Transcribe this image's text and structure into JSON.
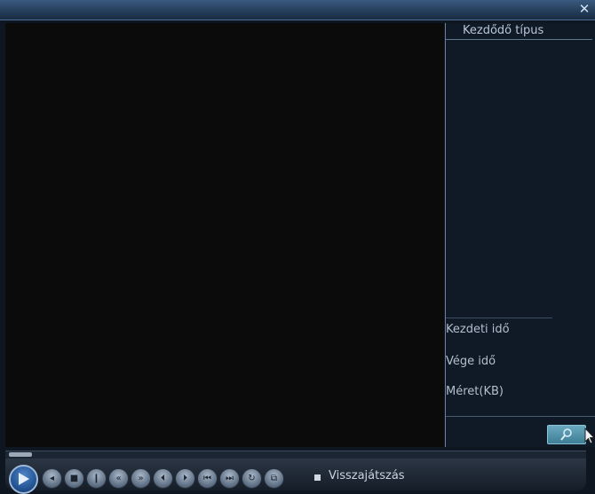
{
  "window": {
    "close_symbol": "✕"
  },
  "file_list": {
    "header_label": "Kezdődő típus"
  },
  "file_info": {
    "start_time_label": "Kezdeti idő",
    "end_time_label": "Vége idő",
    "size_label": "Méret(KB)"
  },
  "playback": {
    "progress_fraction": 0.0,
    "playback_label": "Visszajátszás",
    "controls": [
      {
        "name": "play-icon"
      },
      {
        "name": "step-back-icon",
        "glyph": "◂"
      },
      {
        "name": "stop-icon",
        "glyph": "■"
      },
      {
        "name": "pause-icon",
        "glyph": "❙"
      },
      {
        "name": "rewind-icon",
        "glyph": "«"
      },
      {
        "name": "fast-forward-icon",
        "glyph": "»"
      },
      {
        "name": "prev-frame-icon",
        "glyph": "⏴"
      },
      {
        "name": "next-frame-icon",
        "glyph": "⏵"
      },
      {
        "name": "skip-back-icon",
        "glyph": "⏮"
      },
      {
        "name": "skip-forward-icon",
        "glyph": "⏭"
      },
      {
        "name": "refresh-icon",
        "glyph": "↻"
      },
      {
        "name": "snapshot-icon",
        "glyph": "⧉"
      }
    ]
  }
}
